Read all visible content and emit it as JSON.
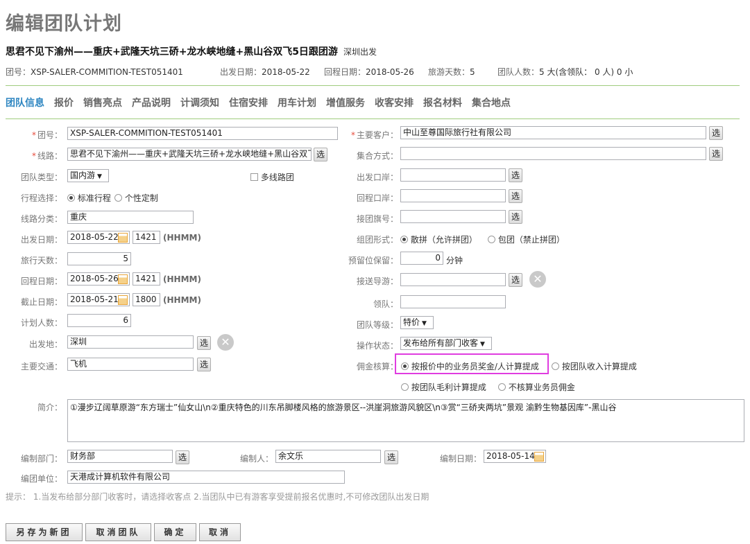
{
  "page_title": "编辑团队计划",
  "route": {
    "title": "思君不见下渝州——重庆+武隆天坑三硚+龙水峡地缝+黑山谷双飞5日跟团游",
    "origin": "深圳出发"
  },
  "meta": {
    "team_no_label": "团号：",
    "team_no": "XSP-SALER-COMMITION-TEST051401",
    "depart_label": "出发日期：",
    "depart": "2018-05-22",
    "return_label": "回程日期：",
    "return": "2018-05-26",
    "days_label": "旅游天数：",
    "days": "5",
    "people_label": "团队人数：",
    "people": "5 大(含领队： 0 人) 0 小"
  },
  "tabs": [
    "团队信息",
    "报价",
    "销售亮点",
    "产品说明",
    "计调须知",
    "住宿安排",
    "用车计划",
    "增值服务",
    "收客安排",
    "报名材料",
    "集合地点"
  ],
  "form": {
    "team_no": {
      "label": "团号：",
      "value": "XSP-SALER-COMMITION-TEST051401"
    },
    "line": {
      "label": "线路：",
      "value": "思君不见下渝州——重庆+武隆天坑三硚+龙水峡地缝+黑山谷双飞"
    },
    "team_type": {
      "label": "团队类型：",
      "value": "国内游"
    },
    "multi_line": "多线路团",
    "itinerary": {
      "label": "行程选择：",
      "opt1": "标准行程",
      "opt2": "个性定制"
    },
    "line_category": {
      "label": "线路分类：",
      "value": "重庆"
    },
    "depart_date": {
      "label": "出发日期：",
      "date": "2018-05-22",
      "time": "1421",
      "hint": "(HHMM)"
    },
    "travel_days": {
      "label": "旅行天数：",
      "value": "5"
    },
    "return_date": {
      "label": "回程日期：",
      "date": "2018-05-26",
      "time": "1421",
      "hint": "(HHMM)"
    },
    "deadline": {
      "label": "截止日期：",
      "date": "2018-05-21",
      "time": "1800",
      "hint": "(HHMM)"
    },
    "plan_people": {
      "label": "计划人数：",
      "value": "6"
    },
    "departure_place": {
      "label": "出发地：",
      "value": "深圳"
    },
    "transport": {
      "label": "主要交通：",
      "value": "飞机"
    },
    "main_customer": {
      "label": "主要客户：",
      "value": "中山至尊国际旅行社有限公司"
    },
    "gather_method": {
      "label": "集合方式：",
      "value": ""
    },
    "depart_port": {
      "label": "出发口岸：",
      "value": ""
    },
    "return_port": {
      "label": "回程口岸：",
      "value": ""
    },
    "flag_no": {
      "label": "接团旗号：",
      "value": ""
    },
    "group_form": {
      "label": "组团形式：",
      "opt1": "散拼（允许拼团）",
      "opt2": "包团（禁止拼团）"
    },
    "reserve": {
      "label": "预留位保留：",
      "value": "0",
      "unit": "分钟"
    },
    "guide": {
      "label": "接送导游：",
      "value": ""
    },
    "leader": {
      "label": "领队：",
      "value": ""
    },
    "level": {
      "label": "团队等级：",
      "value": "特价"
    },
    "op_status": {
      "label": "操作状态：",
      "value": "发布给所有部门收客"
    },
    "commission": {
      "label": "佣金核算：",
      "opt1": "按报价中的业务员奖金/人计算提成",
      "opt2": "按团队收入计算提成",
      "opt3": "按团队毛利计算提成",
      "opt4": "不核算业务员佣金"
    },
    "intro": {
      "label": "简介：",
      "value": "①漫步辽阔草原游“东方瑞士”仙女山\\n②重庆特色的川东吊脚楼风格的旅游景区--洪崖洞旅游风貌区\\n③赏“三硚夹两坑”景观 渝黔生物基因库”-黑山谷"
    },
    "dept": {
      "label": "编制部门：",
      "value": "财务部"
    },
    "editor": {
      "label": "编制人：",
      "value": "余文乐"
    },
    "edit_date": {
      "label": "编制日期：",
      "value": "2018-05-14"
    },
    "unit": {
      "label": "编团单位：",
      "value": "天港成计算机软件有限公司"
    }
  },
  "select_btn": "选",
  "note": "提示： 1.当发布给部分部门收客时，请选择收客点 2.当团队中已有游客享受提前报名优惠时,不可修改团队出发日期",
  "buttons": {
    "save_as": "另存为新团",
    "cancel_team": "取消团队",
    "confirm": "确定",
    "cancel": "取消"
  }
}
